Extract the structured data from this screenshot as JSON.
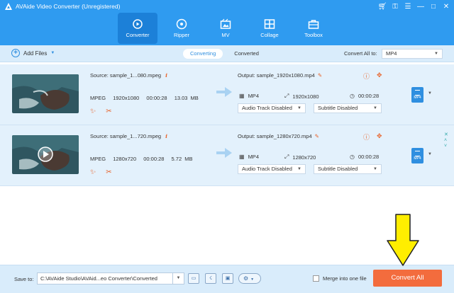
{
  "app": {
    "title": "AVAide Video Converter (Unregistered)"
  },
  "window_controls": [
    "cart-icon",
    "key-icon",
    "menu-icon",
    "minimize-icon",
    "maximize-icon",
    "close-icon"
  ],
  "nav": {
    "tabs": [
      {
        "label": "Converter",
        "icon": "converter-icon",
        "active": true
      },
      {
        "label": "Ripper",
        "icon": "ripper-icon",
        "active": false
      },
      {
        "label": "MV",
        "icon": "mv-icon",
        "active": false
      },
      {
        "label": "Collage",
        "icon": "collage-icon",
        "active": false
      },
      {
        "label": "Toolbox",
        "icon": "toolbox-icon",
        "active": false
      }
    ]
  },
  "toolbar": {
    "add_files": "Add Files",
    "tab_converting": "Converting",
    "tab_converted": "Converted",
    "convert_all_label": "Convert All to:",
    "convert_all_value": "MP4"
  },
  "files": [
    {
      "source": "Source: sample_1...080.mpeg",
      "format": "MPEG",
      "resolution": "1920x1080",
      "duration": "00:00:28",
      "size": "13.03 MB",
      "output": "Output: sample_1920x1080.mp4",
      "out_format": "MP4",
      "out_resolution": "1920x1080",
      "out_duration": "00:00:28",
      "audio": "Audio Track Disabled",
      "subtitle": "Subtitle Disabled",
      "badge": "MP4"
    },
    {
      "source": "Source: sample_1...720.mpeg",
      "format": "MPEG",
      "resolution": "1280x720",
      "duration": "00:00:28",
      "size": "5.72 MB",
      "output": "Output: sample_1280x720.mp4",
      "out_format": "MP4",
      "out_resolution": "1280x720",
      "out_duration": "00:00:28",
      "audio": "Audio Track Disabled",
      "subtitle": "Subtitle Disabled",
      "badge": "MP4"
    }
  ],
  "bottom": {
    "save_to": "Save to:",
    "path": "C:\\AVAide Studio\\AVAid...eo Converter\\Converted",
    "merge": "Merge into one file",
    "convert_button": "Convert All"
  },
  "colors": {
    "brand_blue": "#2f9bf0",
    "accent_orange": "#f36c3d",
    "highlight_arrow": "#ffee00"
  }
}
